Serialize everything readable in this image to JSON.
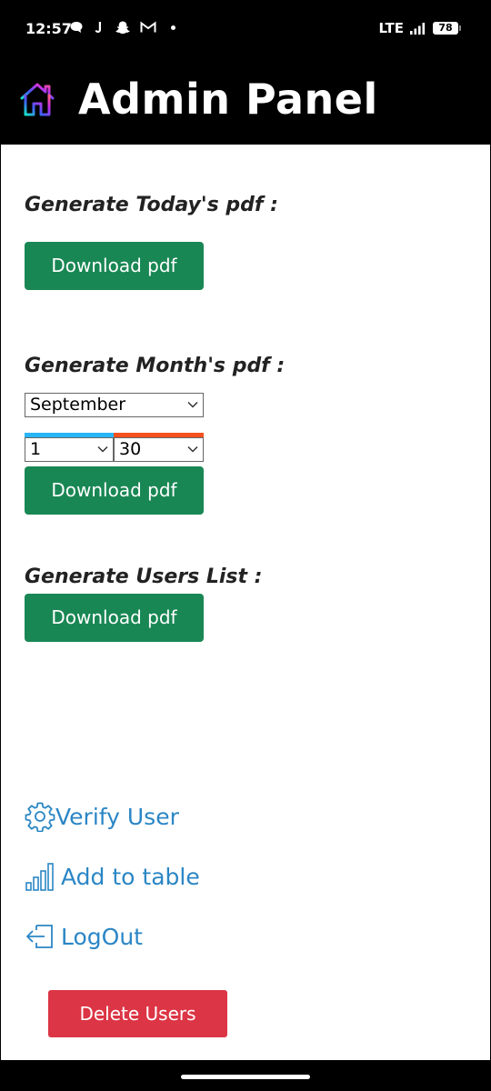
{
  "status_bar": {
    "time": "12:57",
    "network": "LTE",
    "battery": "78",
    "notification_icons": [
      "chat-icon",
      "j-app-icon",
      "snapchat-icon",
      "gmail-icon",
      "more-dot-icon"
    ]
  },
  "header": {
    "title": "Admin Panel",
    "logo_icon": "house-gradient-icon"
  },
  "sections": {
    "today": {
      "label": "Generate Today's pdf :",
      "button": "Download pdf"
    },
    "month": {
      "label": "Generate Month's pdf :",
      "month_select": "September",
      "day_from": "1",
      "day_to": "30",
      "button": "Download pdf"
    },
    "users": {
      "label": "Generate Users List :",
      "button": "Download pdf"
    }
  },
  "links": {
    "verify_user": "Verify User",
    "add_to_table": "Add to table",
    "logout": "LogOut"
  },
  "delete_button": "Delete Users",
  "colors": {
    "green": "#198754",
    "red": "#dc3545",
    "link": "#2b86c5",
    "from_accent": "#29b6f6",
    "to_accent": "#f4511e"
  }
}
